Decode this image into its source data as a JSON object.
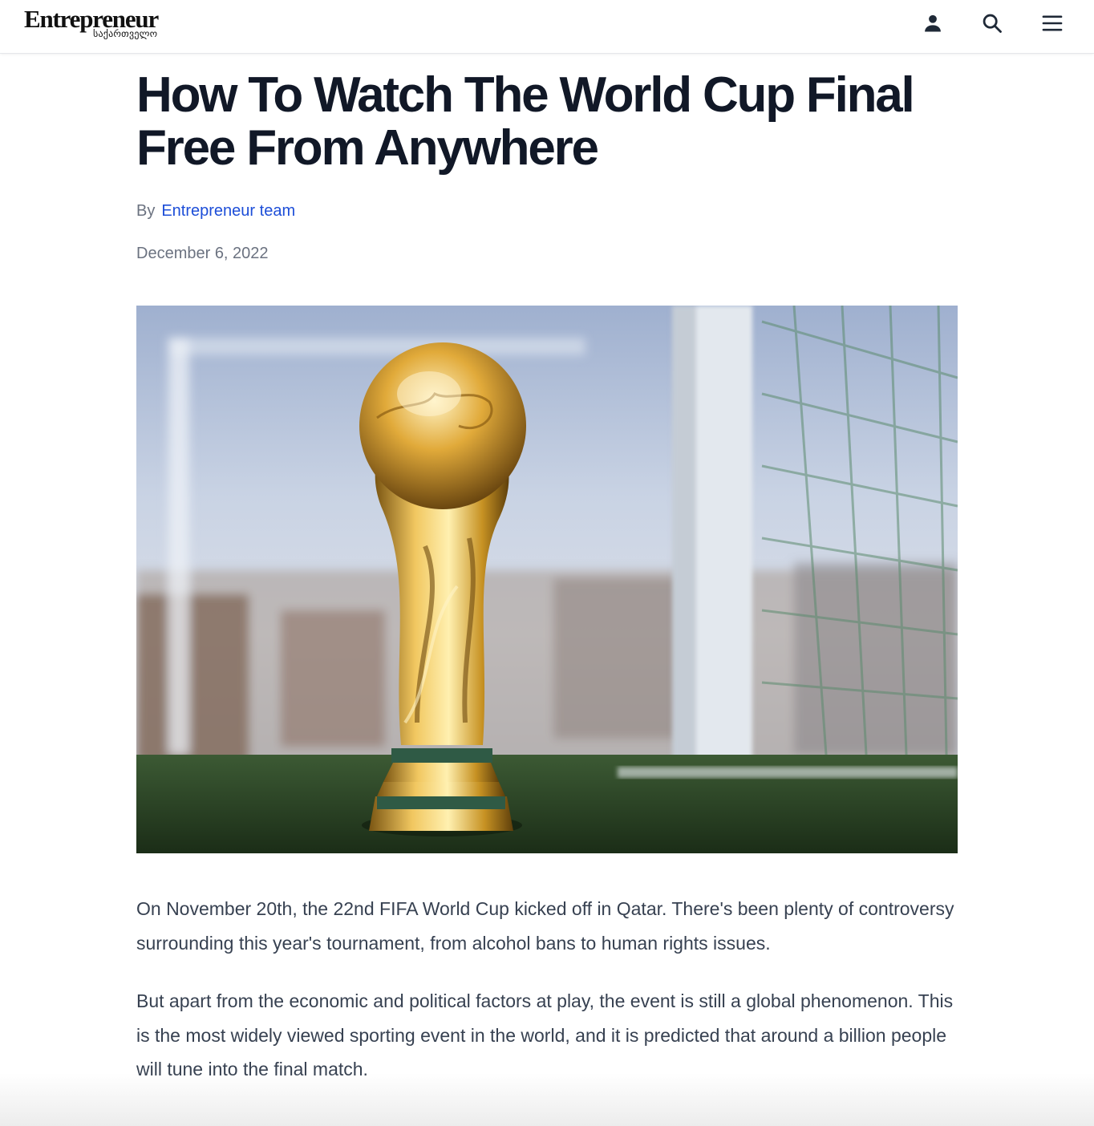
{
  "header": {
    "logo_main": "Entrepreneur",
    "logo_sub": "საქართველო",
    "icons": [
      "user-icon",
      "search-icon",
      "menu-icon"
    ]
  },
  "article": {
    "title": "How To Watch The World Cup Final Free From Anywhere",
    "by_label": "By",
    "author": "Entrepreneur team",
    "date": "December 6, 2022",
    "paragraphs": [
      "On November 20th, the 22nd FIFA World Cup kicked off in Qatar. There's been plenty of controversy surrounding this year's tournament, from alcohol bans to human rights issues.",
      "But apart from the economic and political factors at play, the event is still a global phenomenon. This is the most widely viewed sporting event in the world, and it is predicted that around a billion people will tune into the final match."
    ]
  },
  "colors": {
    "title": "#111827",
    "author_link": "#1d4ed8",
    "muted": "#6b7280",
    "body": "#374151"
  }
}
